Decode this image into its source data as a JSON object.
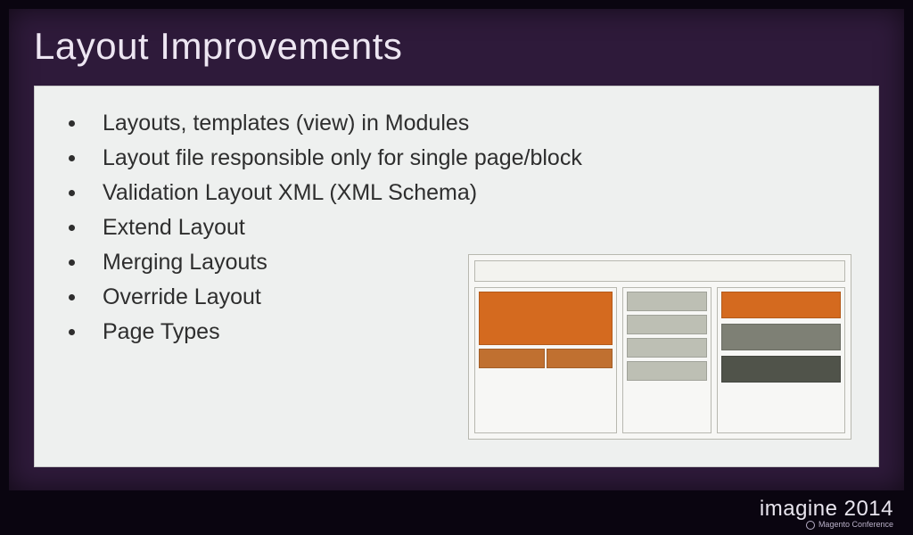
{
  "slide": {
    "title": "Layout Improvements",
    "bullets": [
      "Layouts, templates (view) in Modules",
      "Layout file responsible only for single page/block",
      "Validation Layout XML (XML Schema)",
      "Extend Layout",
      "Merging Layouts",
      "Override Layout",
      "Page Types"
    ]
  },
  "diagram": {
    "name": "page-layout-wireframe",
    "colors": {
      "orange": "#d46a1f",
      "grey_light": "#bdbfb4",
      "grey_mid": "#7e8075",
      "grey_dark": "#50534a"
    }
  },
  "footer": {
    "brand": "imagine",
    "year": "2014",
    "subline": "Magento Conference"
  }
}
